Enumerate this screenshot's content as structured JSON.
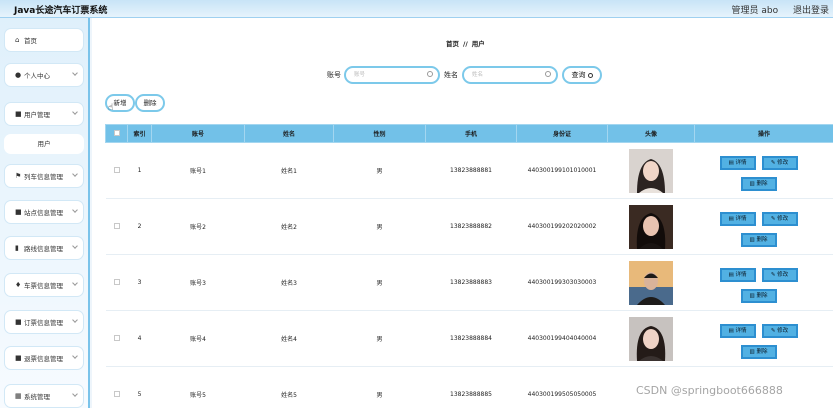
{
  "app": {
    "title": "Java长途汽车订票系统"
  },
  "header": {
    "admin": "管理员 abo",
    "logout": "退出登录"
  },
  "sidebar": {
    "items": [
      {
        "label": "首页",
        "icon": "home-icon",
        "glyph": "⌂"
      },
      {
        "label": "个人中心",
        "icon": "person-icon",
        "glyph": "●"
      },
      {
        "label": "用户管理",
        "icon": "users-icon",
        "glyph": "■"
      },
      {
        "label": "列车信息管理",
        "icon": "flag-icon",
        "glyph": "⚑"
      },
      {
        "label": "站点信息管理",
        "icon": "briefcase-icon",
        "glyph": "■"
      },
      {
        "label": "路线信息管理",
        "icon": "bar-chart-icon",
        "glyph": "▮"
      },
      {
        "label": "车票信息管理",
        "icon": "pin-icon",
        "glyph": "♦"
      },
      {
        "label": "订票信息管理",
        "icon": "clipboard-icon",
        "glyph": "■"
      },
      {
        "label": "退票信息管理",
        "icon": "inbox-icon",
        "glyph": "■"
      },
      {
        "label": "系统管理",
        "icon": "grid-icon",
        "glyph": "▦"
      }
    ],
    "submenu_user": "用户"
  },
  "breadcrumb": {
    "home": "首页",
    "sep": "//",
    "current": "用户"
  },
  "search": {
    "account_label": "账号",
    "account_placeholder": "账号",
    "name_label": "姓名",
    "name_placeholder": "姓名",
    "button": "查询"
  },
  "actions": {
    "add": "新增",
    "delete": "删除"
  },
  "table": {
    "headers": [
      "",
      "索引",
      "账号",
      "姓名",
      "性别",
      "手机",
      "身份证",
      "头像",
      "操作"
    ],
    "rows": [
      {
        "index": "1",
        "account": "账号1",
        "name": "姓名1",
        "gender": "男",
        "phone": "13823888881",
        "idcard": "440300199101010001"
      },
      {
        "index": "2",
        "account": "账号2",
        "name": "姓名2",
        "gender": "男",
        "phone": "13823888882",
        "idcard": "440300199202020002"
      },
      {
        "index": "3",
        "account": "账号3",
        "name": "姓名3",
        "gender": "男",
        "phone": "13823888883",
        "idcard": "440300199303030003"
      },
      {
        "index": "4",
        "account": "账号4",
        "name": "姓名4",
        "gender": "男",
        "phone": "13823888884",
        "idcard": "440300199404040004"
      },
      {
        "index": "5",
        "account": "账号5",
        "name": "姓名5",
        "gender": "男",
        "phone": "13823888885",
        "idcard": "440300199505050005"
      }
    ],
    "op_detail": "详情",
    "op_edit": "修改",
    "op_delete": "删除"
  },
  "watermark": "CSDN @springboot666888",
  "colors": {
    "accent": "#72c1e8",
    "button_bg": "#52b1e3",
    "border": "#7cc9ea"
  }
}
